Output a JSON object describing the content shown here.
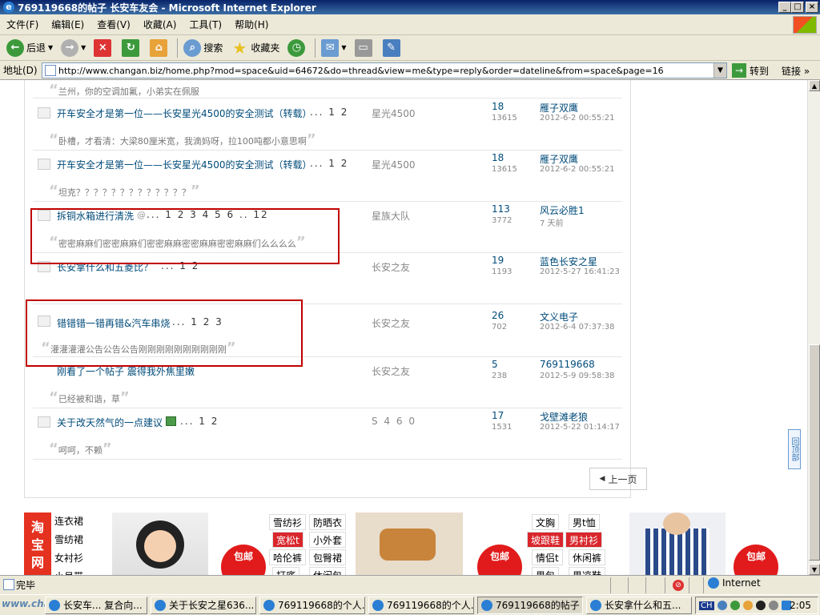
{
  "window": {
    "title": "769119668的帖子 长安车友会 - Microsoft Internet Explorer"
  },
  "menu": [
    "文件(F)",
    "编辑(E)",
    "查看(V)",
    "收藏(A)",
    "工具(T)",
    "帮助(H)"
  ],
  "toolbar": {
    "back": "后退",
    "search": "搜索",
    "favorites": "收藏夹"
  },
  "address": {
    "label": "地址(D)",
    "url": "http://www.changan.biz/home.php?mod=space&uid=64672&do=thread&view=me&type=reply&order=dateline&from=space&page=16",
    "go": "转到",
    "links": "链接"
  },
  "content": {
    "top_quote": "兰州，你的空调加氟，小弟实在佩服",
    "threads": [
      {
        "title": "开车安全才是第一位——长安星光4500的安全测试（转载）",
        "pages": "... 1 2",
        "author": "星光4500",
        "replies": "18",
        "views": "13615",
        "last_user": "雁子双鹰",
        "last_time": "2012-6-2 00:55:21",
        "quote": "卧槽，才看清：大梁80厘米宽，我滴妈呀，拉100吨都小意思啊"
      },
      {
        "title": "开车安全才是第一位——长安星光4500的安全测试（转载）",
        "pages": "... 1 2",
        "author": "星光4500",
        "replies": "18",
        "views": "13615",
        "last_user": "雁子双鹰",
        "last_time": "2012-6-2 00:55:21",
        "quote": "坦克？？？？？？？？？？？？？"
      },
      {
        "title": "拆铜水箱进行清洗",
        "pages": "... 1 2 3 4 5 6 .. 12",
        "author": "星族大队",
        "replies": "113",
        "views": "3772",
        "last_user": "风云必胜1",
        "last_time": "7 天前",
        "quote": "密密麻麻们密密麻麻们密密麻麻密密麻麻密密麻麻们么么么么"
      },
      {
        "title": "长安拿什么和五菱比？",
        "pages": "... 1 2",
        "author": "长安之友",
        "replies": "19",
        "views": "1193",
        "last_user": "蓝色长安之星",
        "last_time": "2012-5-27 16:41:23",
        "quote": ""
      },
      {
        "title": "错错错一错再错&汽车串烧",
        "pages": "... 1 2 3",
        "author": "长安之友",
        "replies": "26",
        "views": "702",
        "last_user": "文义电子",
        "last_time": "2012-6-4 07:37:38",
        "quote": "灌灌灌灌公告公告公告刚刚刚刚刚刚刚刚刚刚"
      },
      {
        "title": "刚看了一个帖子 震得我外焦里嫩",
        "pages": "",
        "author": "长安之友",
        "replies": "5",
        "views": "238",
        "last_user": "769119668",
        "last_time": "2012-5-9 09:58:38",
        "quote": "已经被和谐，草"
      },
      {
        "title": "关于改天然气的一点建议",
        "pages": "... 1 2",
        "author": "S 4 6 0",
        "replies": "17",
        "views": "1531",
        "last_user": "戈壁滩老狼",
        "last_time": "2012-5-22 01:14:17",
        "quote": "呵呵，不赖"
      }
    ],
    "prev_page": "上一页",
    "back_to_top": "回顶部"
  },
  "ad": {
    "logo": "淘宝网",
    "categories": [
      "连衣裙",
      "雪纺裙",
      "女衬衫",
      "小吊带"
    ],
    "tags1": [
      "雪纺衫",
      "防晒衣",
      "宽松t",
      "小外套",
      "哈伦裤",
      "包臀裙",
      "打底",
      "休闲包"
    ],
    "tags2": [
      "文胸",
      "男t恤",
      "坡跟鞋",
      "男衬衫",
      "情侣t",
      "休闲裤",
      "男包",
      "男凉鞋"
    ],
    "baoyou": "包邮"
  },
  "status": {
    "text": "完毕",
    "zone": "Internet"
  },
  "taskbar": {
    "tasks": [
      "长安车... 复合向...",
      "关于长安之星636...",
      "769119668的个人...",
      "769119668的个人...",
      "769119668的帖子 ...",
      "长安拿什么和五..."
    ],
    "watermark": "www.changan.biz",
    "lang": "CH",
    "time": "2:05"
  }
}
